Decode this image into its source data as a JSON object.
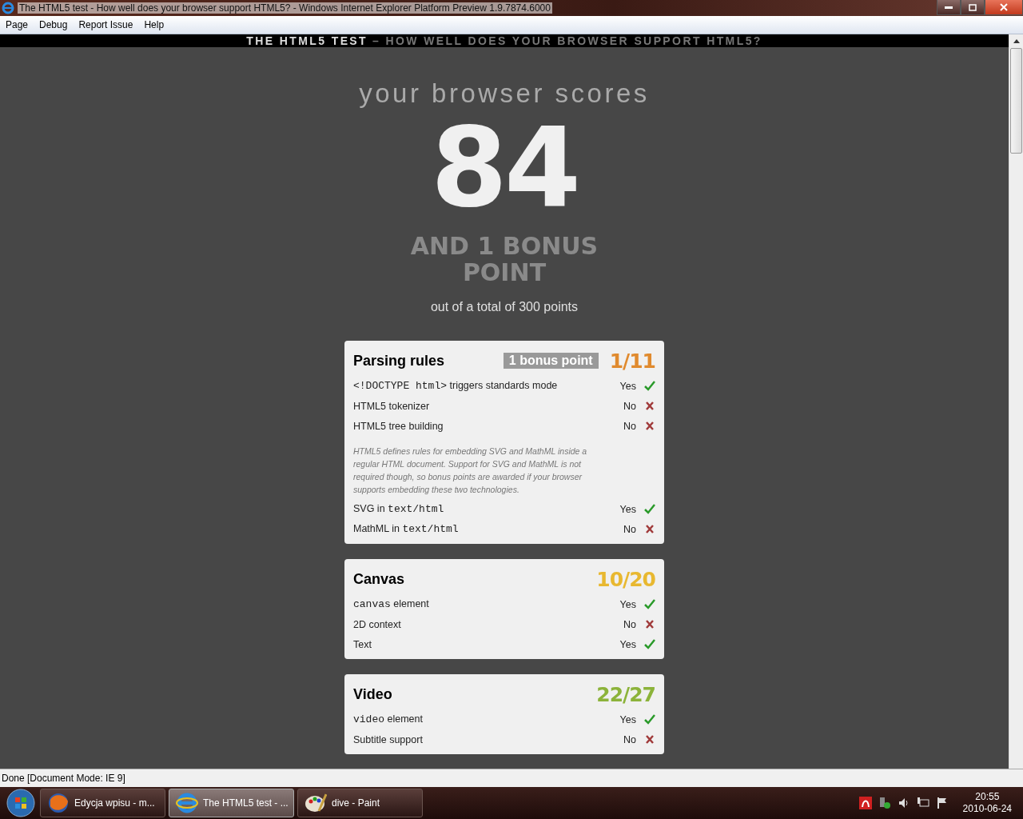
{
  "window": {
    "title": "The HTML5 test - How well does your browser support HTML5? - Windows Internet Explorer Platform Preview 1.9.7874.6000"
  },
  "menu": [
    "Page",
    "Debug",
    "Report Issue",
    "Help"
  ],
  "header": {
    "title": "THE HTML5 TEST",
    "subtitle": "– HOW WELL DOES YOUR BROWSER SUPPORT HTML5?"
  },
  "score": {
    "intro": "your browser scores",
    "value": "84",
    "bonus": "AND 1 BONUS POINT",
    "total": "out of a total of 300 points"
  },
  "sections": [
    {
      "title": "Parsing rules",
      "badge": "1 bonus point",
      "score": "1/11",
      "color": "#e08a2e",
      "items": [
        {
          "kind": "test",
          "label": [
            {
              "text": "<!DOCTYPE html>",
              "mono": true
            },
            {
              "text": " triggers standards mode",
              "mono": false
            }
          ],
          "result": "Yes",
          "passed": true
        },
        {
          "kind": "test",
          "label": [
            {
              "text": "HTML5 tokenizer",
              "mono": false
            }
          ],
          "result": "No",
          "passed": false
        },
        {
          "kind": "test",
          "label": [
            {
              "text": "HTML5 tree building",
              "mono": false
            }
          ],
          "result": "No",
          "passed": false
        },
        {
          "kind": "note",
          "text": "HTML5 defines rules for embedding SVG and MathML inside a regular HTML document. Support for SVG and MathML is not required though, so bonus points are awarded if your browser supports embedding these two technologies."
        },
        {
          "kind": "test",
          "label": [
            {
              "text": "SVG in ",
              "mono": false
            },
            {
              "text": "text/html",
              "mono": true
            }
          ],
          "result": "Yes",
          "passed": true
        },
        {
          "kind": "test",
          "label": [
            {
              "text": "MathML in ",
              "mono": false
            },
            {
              "text": "text/html",
              "mono": true
            }
          ],
          "result": "No",
          "passed": false
        }
      ]
    },
    {
      "title": "Canvas",
      "score": "10/20",
      "color": "#e8b830",
      "items": [
        {
          "kind": "test",
          "label": [
            {
              "text": "canvas",
              "mono": true
            },
            {
              "text": " element",
              "mono": false
            }
          ],
          "result": "Yes",
          "passed": true
        },
        {
          "kind": "test",
          "label": [
            {
              "text": "2D context",
              "mono": false
            }
          ],
          "result": "No",
          "passed": false
        },
        {
          "kind": "test",
          "label": [
            {
              "text": "Text",
              "mono": false
            }
          ],
          "result": "Yes",
          "passed": true
        }
      ]
    },
    {
      "title": "Video",
      "score": "22/27",
      "color": "#8cb33a",
      "items": [
        {
          "kind": "test",
          "label": [
            {
              "text": "video",
              "mono": true
            },
            {
              "text": " element",
              "mono": false
            }
          ],
          "result": "Yes",
          "passed": true
        },
        {
          "kind": "test",
          "label": [
            {
              "text": "Subtitle support",
              "mono": false
            }
          ],
          "result": "No",
          "passed": false
        }
      ]
    }
  ],
  "status_bar": "Done [Document Mode: IE 9]",
  "taskbar": {
    "items": [
      {
        "label": "Edycja wpisu - m...",
        "selected": false
      },
      {
        "label": "The HTML5 test - ...",
        "selected": true
      },
      {
        "label": "dive - Paint",
        "selected": false
      }
    ],
    "time": "20:55",
    "date": "2010-06-24"
  }
}
